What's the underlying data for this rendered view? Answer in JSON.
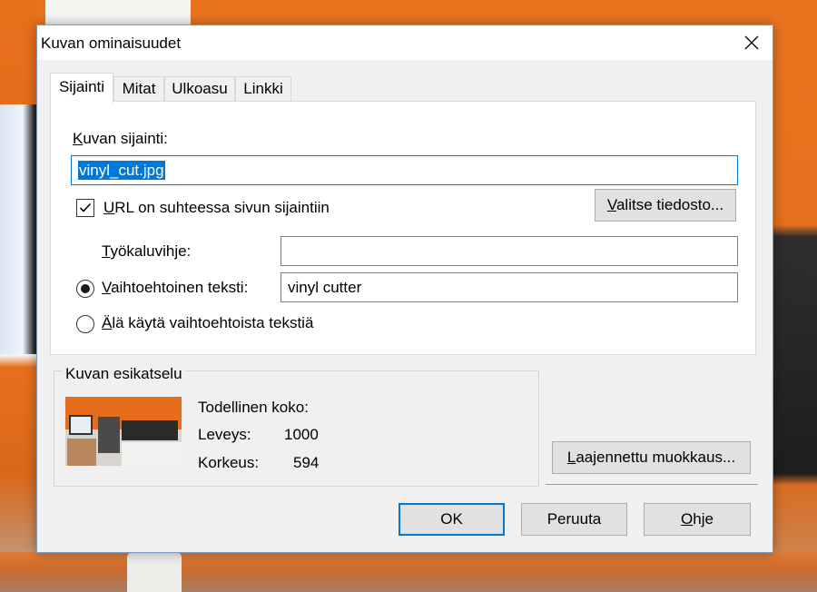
{
  "dialog": {
    "title": "Kuvan ominaisuudet",
    "close_icon": "close-icon"
  },
  "tabs": [
    {
      "label": "Sijainti",
      "active": true
    },
    {
      "label": "Mitat",
      "active": false
    },
    {
      "label": "Ulkoasu",
      "active": false
    },
    {
      "label": "Linkki",
      "active": false
    }
  ],
  "location": {
    "label_first": "K",
    "label_rest": "uvan sijainti:",
    "value": "vinyl_cut.jpg",
    "relative_checkbox_label_first": "U",
    "relative_checkbox_label_rest": "RL on suhteessa sivun sijaintiin",
    "relative_checked": true,
    "choose_file_first": "V",
    "choose_file_rest": "alitse tiedosto..."
  },
  "tooltip": {
    "label_first": "T",
    "label_rest": "yökaluvihje:",
    "value": ""
  },
  "alt_text": {
    "radio_label_first": "V",
    "radio_label_rest": "aihtoehtoinen teksti:",
    "selected": true,
    "value": "vinyl cutter",
    "no_alt_label_first": "Ä",
    "no_alt_label_rest": "lä käytä vaihtoehtoista tekstiä"
  },
  "preview": {
    "title": "Kuvan esikatselu",
    "actual_size_label": "Todellinen koko:",
    "width_label": "Leveys:",
    "width_value": "1000",
    "height_label": "Korkeus:",
    "height_value": "594"
  },
  "advanced_edit": {
    "label_first": "L",
    "label_rest": "aajennettu muokkaus..."
  },
  "buttons": {
    "ok": "OK",
    "cancel": "Peruuta",
    "help_first": "O",
    "help_rest": "hje"
  },
  "colors": {
    "accent": "#0078d7",
    "dialog_bg": "#f0f0f0"
  }
}
